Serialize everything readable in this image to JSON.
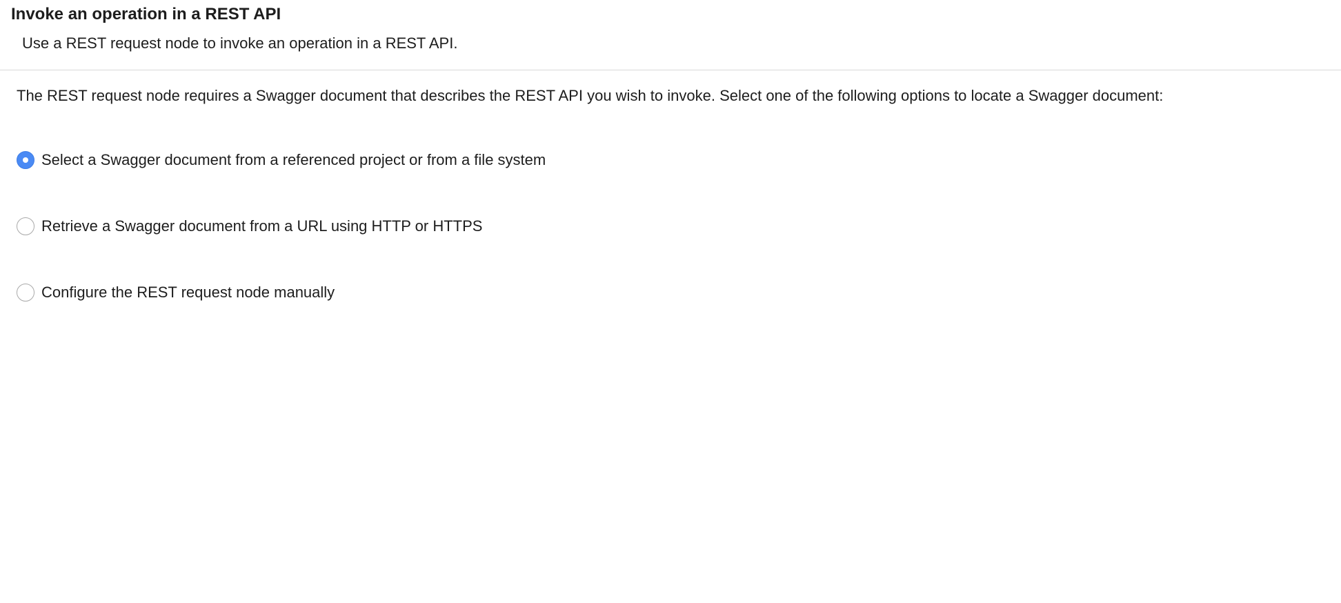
{
  "header": {
    "title": "Invoke an operation in a REST API",
    "subtitle": "Use a REST request node to invoke an operation in a REST API."
  },
  "main": {
    "description": "The REST request node requires a Swagger document that describes the REST API you wish to invoke. Select one of the following options to locate a Swagger document:",
    "options": [
      {
        "label": "Select a Swagger document from a referenced project or from a file system",
        "selected": true
      },
      {
        "label": "Retrieve a Swagger document from a URL using HTTP or HTTPS",
        "selected": false
      },
      {
        "label": "Configure the REST request node manually",
        "selected": false
      }
    ]
  },
  "colors": {
    "accent": "#4a8af4",
    "divider": "#d9d9d9",
    "radio_border": "#a9a9a9"
  }
}
